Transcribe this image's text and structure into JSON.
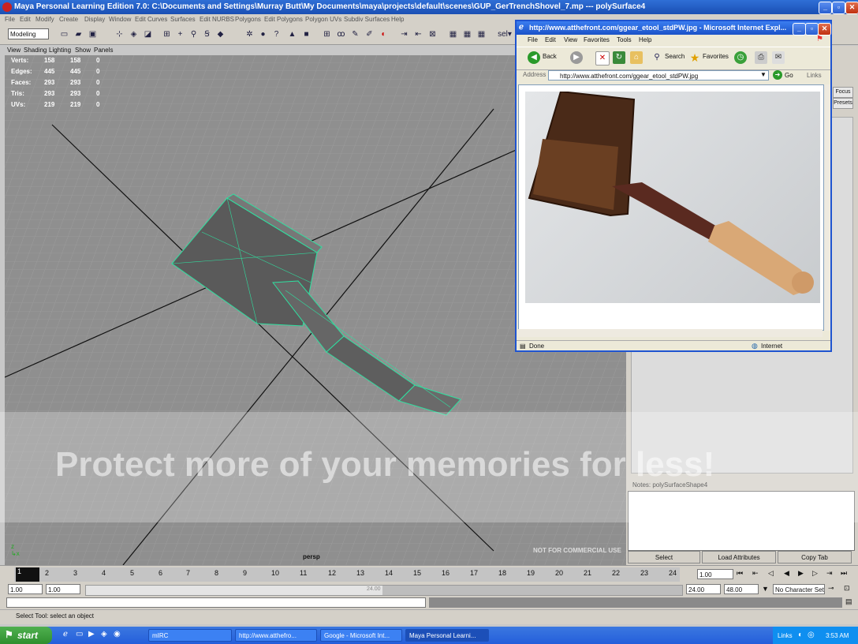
{
  "maya": {
    "title": "Maya Personal Learning Edition 7.0: C:\\Documents and Settings\\Murray Butt\\My Documents\\maya\\projects\\default\\scenes\\GUP_GerTrenchShovel_7.mp   ---   polySurface4",
    "menus": [
      "File",
      "Edit",
      "Modify",
      "Create",
      "Display",
      "Window",
      "Edit Curves",
      "Surfaces",
      "Edit NURBS",
      "Polygons",
      "Edit Polygons",
      "Polygon UVs",
      "Subdiv Surfaces",
      "Help"
    ],
    "mode": "Modeling",
    "sel_label": "sel▾",
    "panel_menus": [
      "View",
      "Shading",
      "Lighting",
      "Show",
      "Panels"
    ],
    "hud": [
      {
        "label": "Verts:",
        "a": "158",
        "b": "158",
        "c": "0"
      },
      {
        "label": "Edges:",
        "a": "445",
        "b": "445",
        "c": "0"
      },
      {
        "label": "Faces:",
        "a": "293",
        "b": "293",
        "c": "0"
      },
      {
        "label": "Tris:",
        "a": "293",
        "b": "293",
        "c": "0"
      },
      {
        "label": "UVs:",
        "a": "219",
        "b": "219",
        "c": "0"
      }
    ],
    "camera": "persp",
    "ncu": "NOT FOR COMMERCIAL USE",
    "notes_label": "Notes:  polySurfaceShape4",
    "right_buttons": [
      "Select",
      "Load Attributes",
      "Copy Tab"
    ],
    "right_tabs": [
      "Focus",
      "Presets"
    ],
    "timeline_ticks": [
      "2",
      "3",
      "4",
      "5",
      "6",
      "7",
      "8",
      "9",
      "10",
      "11",
      "12",
      "13",
      "14",
      "15",
      "16",
      "17",
      "18",
      "19",
      "20",
      "21",
      "22",
      "23",
      "24"
    ],
    "current_frame": "1",
    "frame_field": "1.00",
    "range_start": "1.00",
    "range_start2": "1.00",
    "range_end": "24.00",
    "range_end2": "48.00",
    "range_inner_end": "24.00",
    "char_set": "No Character Set",
    "help_text": "Select Tool: select an object"
  },
  "watermark": {
    "tagline": "Protect more of your memories for less!"
  },
  "ie": {
    "title": "http://www.atthefront.com/ggear_etool_stdPW.jpg - Microsoft Internet Expl...",
    "menus": [
      "File",
      "Edit",
      "View",
      "Favorites",
      "Tools",
      "Help"
    ],
    "back": "Back",
    "search": "Search",
    "favorites": "Favorites",
    "address_label": "Address",
    "address": "http://www.atthefront.com/ggear_etool_stdPW.jpg",
    "go": "Go",
    "links": "Links",
    "status": "Done",
    "zone": "Internet"
  },
  "taskbar": {
    "start": "start",
    "tasks": [
      "mIRC",
      "http://www.atthefro...",
      "Google - Microsoft Int...",
      "Maya Personal Learni..."
    ],
    "links": "Links",
    "clock": "3:53 AM"
  }
}
